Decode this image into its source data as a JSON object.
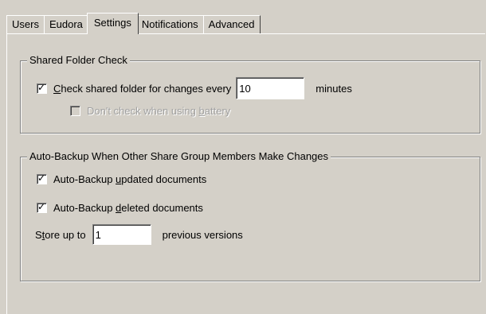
{
  "tabs": [
    {
      "label": "Users",
      "active": false
    },
    {
      "label": "Eudora",
      "active": false
    },
    {
      "label": "Settings",
      "active": true
    },
    {
      "label": "Notifications",
      "active": false
    },
    {
      "label": "Advanced",
      "active": false
    }
  ],
  "shared_folder_check": {
    "title": "Shared Folder Check",
    "check_shared": {
      "label_pre": "",
      "label_underlined": "C",
      "label_post": "heck shared folder for changes every",
      "checked": true
    },
    "interval_value": "10",
    "interval_unit": "minutes",
    "battery": {
      "label_pre": "Don't check when using ",
      "label_underlined": "b",
      "label_post": "attery",
      "checked": false,
      "disabled": true
    }
  },
  "auto_backup": {
    "title": "Auto-Backup When Other Share Group Members Make Changes",
    "updated": {
      "label_pre": "Auto-Backup ",
      "label_underlined": "u",
      "label_post": "pdated documents",
      "checked": true
    },
    "deleted": {
      "label_pre": "Auto-Backup ",
      "label_underlined": "d",
      "label_post": "eleted documents",
      "checked": true
    },
    "store": {
      "label_pre": "S",
      "label_underlined": "t",
      "label_post": "ore up to",
      "value": "1",
      "suffix": "previous versions"
    }
  },
  "check_glyph": "✓"
}
